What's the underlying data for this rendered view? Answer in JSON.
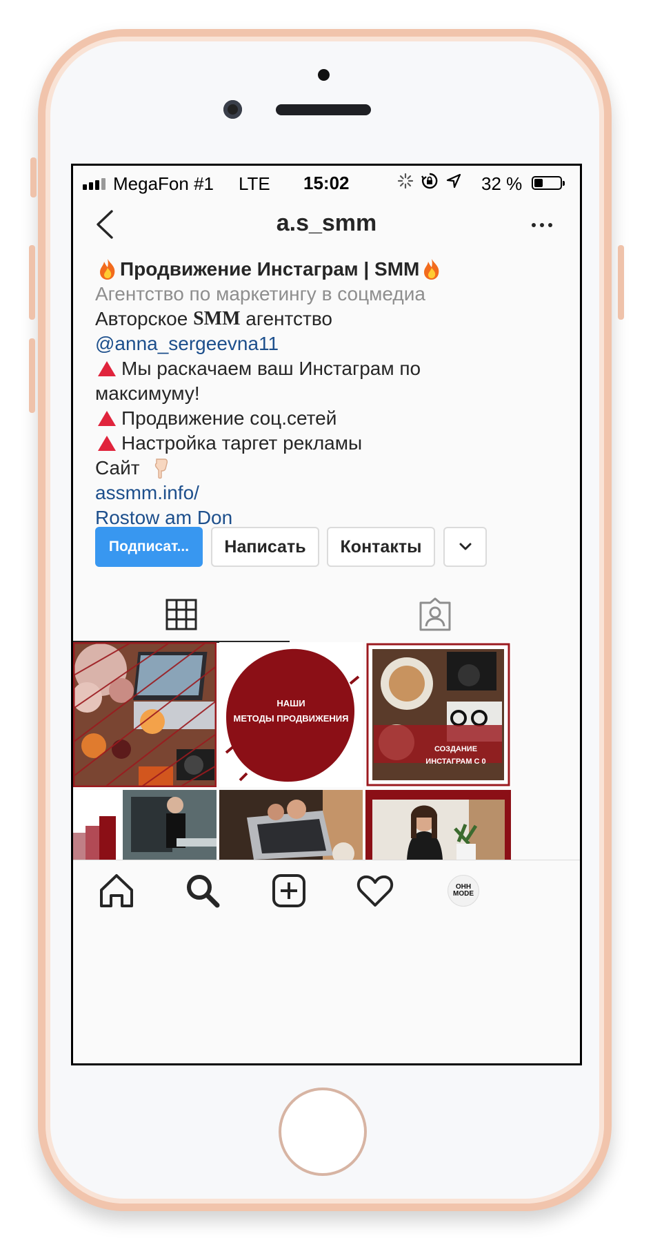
{
  "status_bar": {
    "carrier": "MegaFon #1",
    "network": "LTE",
    "time": "15:02",
    "battery_percent": "32 %",
    "battery_level": 0.32,
    "icons": [
      "signal-bars-icon",
      "loading-spinner-icon",
      "rotation-lock-icon",
      "location-arrow-icon",
      "battery-icon"
    ]
  },
  "header": {
    "username": "a.s_smm",
    "back_icon": "chevron-left-icon",
    "more_icon": "more-dots-icon"
  },
  "profile": {
    "name": "Продвижение Инстаграм | SMM",
    "category": "Агентство по маркетингу в соцмедиа",
    "bio_line1_prefix": "Авторское ",
    "bio_line1_bold": "SMM",
    "bio_line1_suffix": " агентство",
    "mention": "@anna_sergeevna11",
    "bullet1_a": "Мы раскачаем ваш Инстаграм по",
    "bullet1_b": "максимуму!",
    "bullet2": "Продвижение соц.сетей",
    "bullet3": "Настройка таргет рекламы",
    "site_label": "Сайт",
    "website": "assmm.info/",
    "location": "Rostow am Don"
  },
  "actions": {
    "follow": "Подписат...",
    "message": "Написать",
    "contacts": "Контакты"
  },
  "tabs": [
    "grid-icon",
    "tagged-icon"
  ],
  "posts": [
    {
      "caption": ""
    },
    {
      "caption_line1": "НАШИ",
      "caption_line2": "МЕТОДЫ ПРОДВИЖЕНИЯ"
    },
    {
      "caption_line1": "СОЗДАНИЕ",
      "caption_line2": "ИНСТАГРАМ С 0"
    }
  ],
  "bottom_nav": {
    "items": [
      "home-icon",
      "search-icon",
      "new-post-icon",
      "activity-heart-icon",
      "profile-avatar"
    ],
    "avatar_text_line1": "OHH",
    "avatar_text_line2": "MODE"
  },
  "colors": {
    "accent": "#3897f0",
    "link": "#1d4f8c",
    "brand_red": "#8b0f16",
    "frame": "#f1c4ac"
  }
}
